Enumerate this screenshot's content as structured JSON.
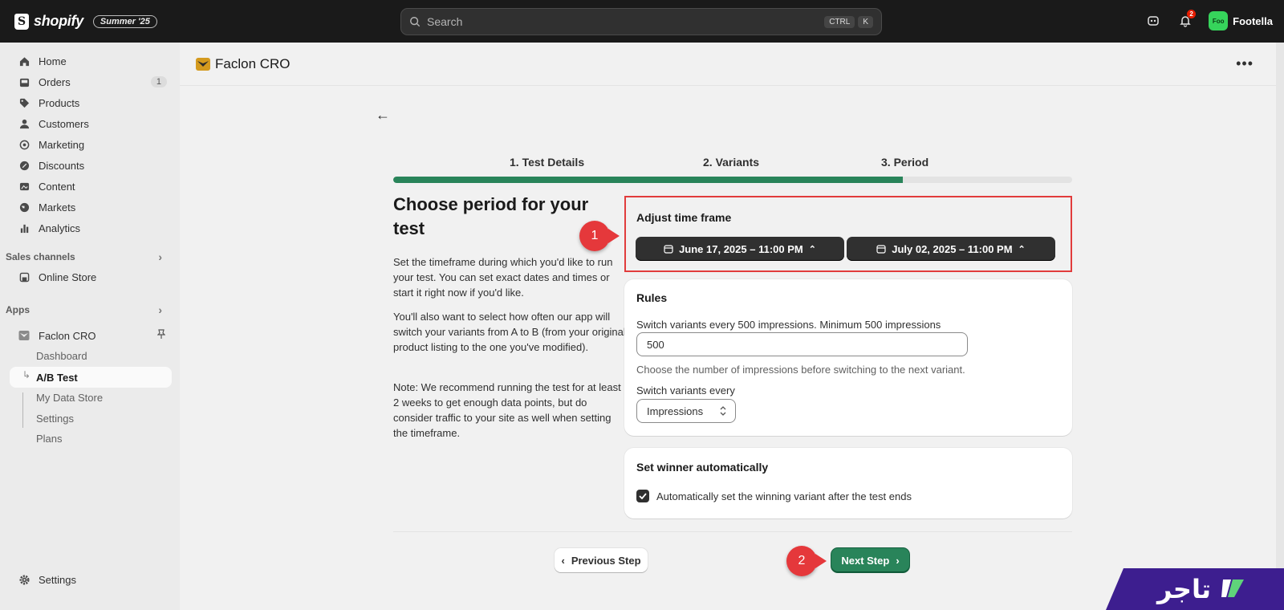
{
  "topbar": {
    "logo_text": "shopify",
    "edition": "Summer '25",
    "search_placeholder": "Search",
    "kbd1": "CTRL",
    "kbd2": "K",
    "notif_count": "2",
    "store_initials": "Foo",
    "store_name": "Footella"
  },
  "sidebar": {
    "items": [
      {
        "label": "Home",
        "icon": "home-icon"
      },
      {
        "label": "Orders",
        "icon": "orders-icon",
        "count": "1"
      },
      {
        "label": "Products",
        "icon": "tag-icon"
      },
      {
        "label": "Customers",
        "icon": "person-icon"
      },
      {
        "label": "Marketing",
        "icon": "target-icon"
      },
      {
        "label": "Discounts",
        "icon": "discount-icon"
      },
      {
        "label": "Content",
        "icon": "image-icon"
      },
      {
        "label": "Markets",
        "icon": "globe-icon"
      },
      {
        "label": "Analytics",
        "icon": "bar-chart-icon"
      }
    ],
    "sales_channels_label": "Sales channels",
    "online_store": "Online Store",
    "apps_label": "Apps",
    "app_name": "Faclon CRO",
    "app_subitems": [
      "Dashboard",
      "A/B Test",
      "My Data Store",
      "Settings",
      "Plans"
    ],
    "settings": "Settings"
  },
  "header": {
    "app_title": "Faclon CRO"
  },
  "steps": [
    "1. Test Details",
    "2. Variants",
    "3. Period"
  ],
  "progress_fraction": 0.75,
  "left": {
    "title": "Choose period for your test",
    "para1": "Set the timeframe during which you'd like to run your test. You can set exact dates and times or start it right now if you'd like.",
    "para2": "You'll also want to select how often our app will switch your variants from A to B (from your original product listing to the one you've modified).",
    "para3": "Note: We recommend running the test for at least 2 weeks to get enough data points, but do consider traffic to your site as well when setting the timeframe."
  },
  "timeframe": {
    "title": "Adjust time frame",
    "start": "June 17, 2025 – 11:00 PM",
    "end": "July 02, 2025 – 11:00 PM"
  },
  "rules": {
    "title": "Rules",
    "label1": "Switch variants every 500 impressions. Minimum 500 impressions",
    "value": "500",
    "help": "Choose the number of impressions before switching to the next variant.",
    "label2": "Switch variants every",
    "select_value": "Impressions"
  },
  "winner": {
    "title": "Set winner automatically",
    "checkbox_label": "Automatically set the winning variant after the test ends",
    "checked": true
  },
  "footer": {
    "prev": "Previous Step",
    "next": "Next Step"
  },
  "callouts": [
    "1",
    "2"
  ],
  "watermark": "تاجر",
  "colors": {
    "accent_green": "#29845a",
    "highlight_red": "#e13c3c",
    "callout_red": "#e5383b",
    "brand_purple": "#3d1e8f"
  }
}
